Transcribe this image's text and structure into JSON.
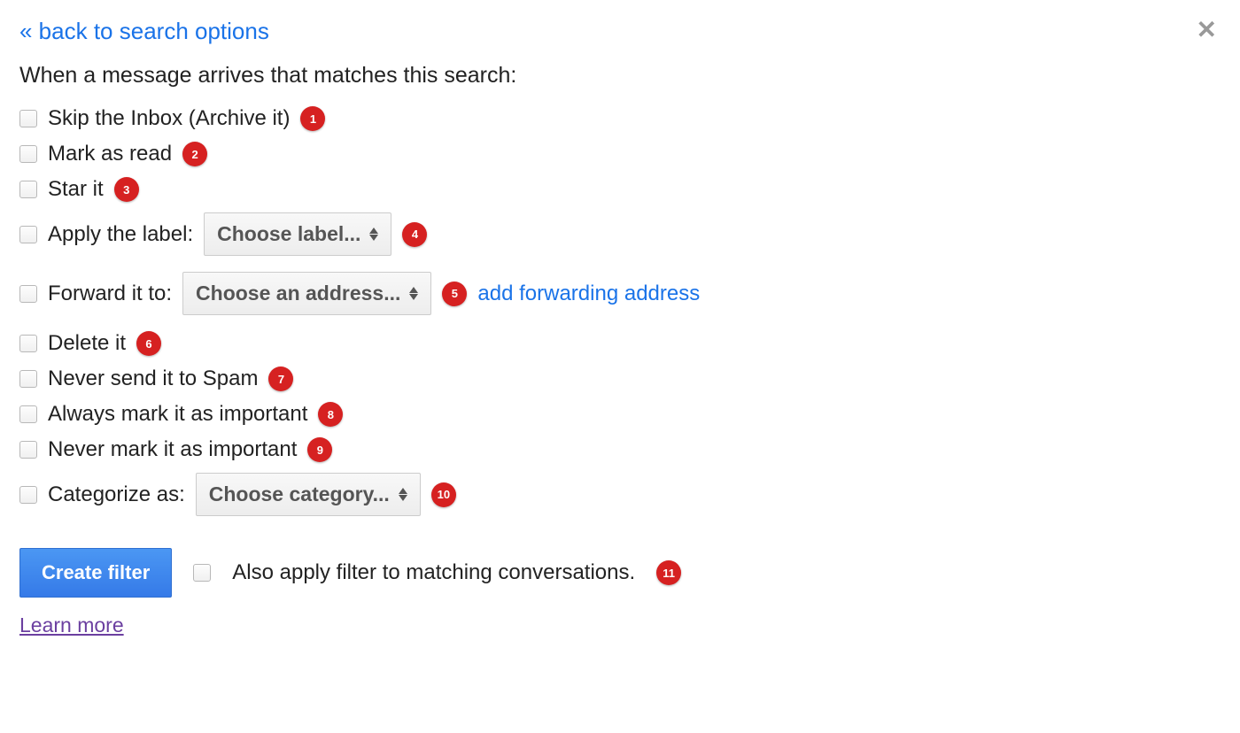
{
  "backLink": "« back to search options",
  "closeGlyph": "✕",
  "heading": "When a message arrives that matches this search:",
  "options": {
    "skipInbox": {
      "label": "Skip the Inbox (Archive it)",
      "badge": "1"
    },
    "markRead": {
      "label": "Mark as read",
      "badge": "2"
    },
    "starIt": {
      "label": "Star it",
      "badge": "3"
    },
    "applyLabel": {
      "label": "Apply the label:",
      "select": "Choose label...",
      "badge": "4"
    },
    "forwardTo": {
      "label": "Forward it to:",
      "select": "Choose an address...",
      "badge": "5",
      "extraLink": "add forwarding address"
    },
    "deleteIt": {
      "label": "Delete it",
      "badge": "6"
    },
    "neverSpam": {
      "label": "Never send it to Spam",
      "badge": "7"
    },
    "alwaysImp": {
      "label": "Always mark it as important",
      "badge": "8"
    },
    "neverImp": {
      "label": "Never mark it as important",
      "badge": "9"
    },
    "categorize": {
      "label": "Categorize as:",
      "select": "Choose category...",
      "badge": "10"
    },
    "alsoApply": {
      "label": "Also apply filter to matching conversations.",
      "badge": "11"
    }
  },
  "createButton": "Create filter",
  "learnMore": "Learn more"
}
